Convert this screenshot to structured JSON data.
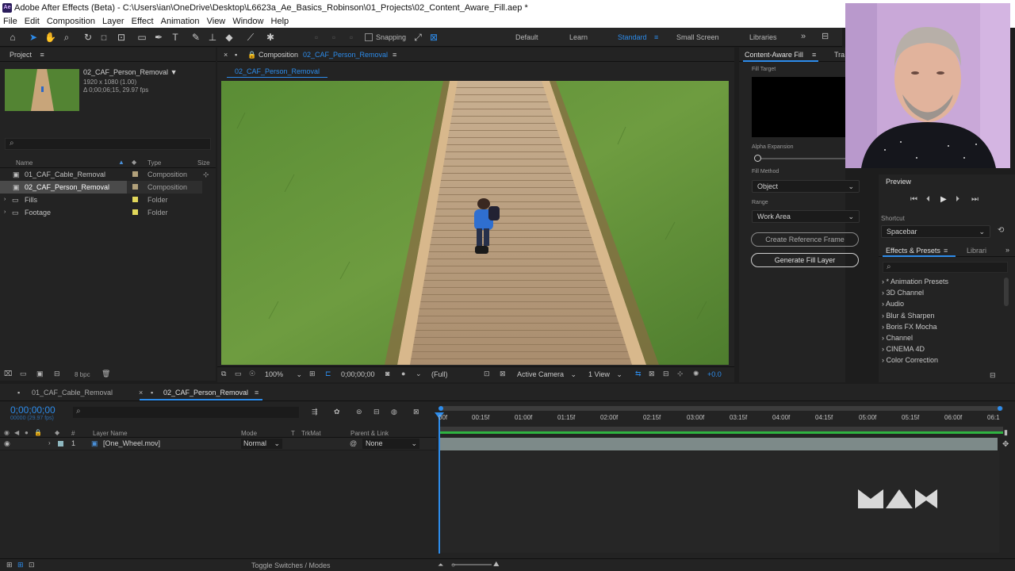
{
  "app": {
    "title": "Adobe After Effects (Beta) - C:\\Users\\ian\\OneDrive\\Desktop\\L6623a_Ae_Basics_Robinson\\01_Projects\\02_Content_Aware_Fill.aep *",
    "logo_text": "Ae",
    "menu": [
      "File",
      "Edit",
      "Composition",
      "Layer",
      "Effect",
      "Animation",
      "View",
      "Window",
      "Help"
    ]
  },
  "toolbar": {
    "snapping_label": "Snapping",
    "workspaces": [
      "Default",
      "Learn",
      "Standard",
      "Small Screen",
      "Libraries"
    ],
    "active_workspace": "Standard",
    "accent": "#2d8ceb"
  },
  "project": {
    "panel_title": "Project",
    "comp_name": "02_CAF_Person_Removal",
    "comp_size": "1920 x 1080 (1.00)",
    "comp_duration": "Δ 0;00;06;15, 29.97 fps",
    "search_icon": "search-icon",
    "columns": {
      "name": "Name",
      "type": "Type",
      "size": "Size"
    },
    "items": [
      {
        "name": "01_CAF_Cable_Removal",
        "type": "Composition",
        "color": "#b1a07a"
      },
      {
        "name": "02_CAF_Person_Removal",
        "type": "Composition",
        "color": "#b1a07a"
      },
      {
        "name": "Fills",
        "type": "Folder",
        "color": "#e1d75a"
      },
      {
        "name": "Footage",
        "type": "Folder",
        "color": "#e1d75a"
      }
    ],
    "bpc": "8 bpc"
  },
  "composition": {
    "tab_label": "Composition",
    "tab_comp_name": "02_CAF_Person_Removal",
    "breadcrumb": "02_CAF_Person_Removal",
    "zoom": "100%",
    "timecode": "0;00;00;00",
    "resolution": "(Full)",
    "camera": "Active Camera",
    "views": "1 View",
    "exposure": "+0.0"
  },
  "caf": {
    "panel_title": "Content-Aware Fill",
    "second_tab": "Tra",
    "fill_target_label": "Fill Target",
    "alpha_expansion_label": "Alpha Expansion",
    "fill_method_label": "Fill Method",
    "fill_method_value": "Object",
    "range_label": "Range",
    "range_value": "Work Area",
    "create_ref_label": "Create Reference Frame",
    "generate_label": "Generate Fill Layer"
  },
  "preview": {
    "panel_title": "Preview",
    "shortcut_label": "Shortcut",
    "shortcut_value": "Spacebar"
  },
  "effects": {
    "panel_title": "Effects & Presets",
    "second_tab": "Librari",
    "items": [
      "* Animation Presets",
      "3D Channel",
      "Audio",
      "Blur & Sharpen",
      "Boris FX Mocha",
      "Channel",
      "CINEMA 4D",
      "Color Correction"
    ]
  },
  "timeline": {
    "tabs": [
      "01_CAF_Cable_Removal",
      "02_CAF_Person_Removal"
    ],
    "timecode": "0;00;00;00",
    "timecode_sub": "00000 (29.97 fps)",
    "columns": {
      "layer_name": "Layer Name",
      "mode": "Mode",
      "t": "T",
      "trkmat": "TrkMat",
      "parent": "Parent & Link"
    },
    "layer": {
      "index": "1",
      "name": "[One_Wheel.mov]",
      "mode": "Normal",
      "parent": "None"
    },
    "ruler": [
      "00f",
      "00:15f",
      "01:00f",
      "01:15f",
      "02:00f",
      "02:15f",
      "03:00f",
      "03:15f",
      "04:00f",
      "04:15f",
      "05:00f",
      "05:15f",
      "06:00f",
      "06:1"
    ],
    "toggle_label": "Toggle Switches / Modes"
  }
}
